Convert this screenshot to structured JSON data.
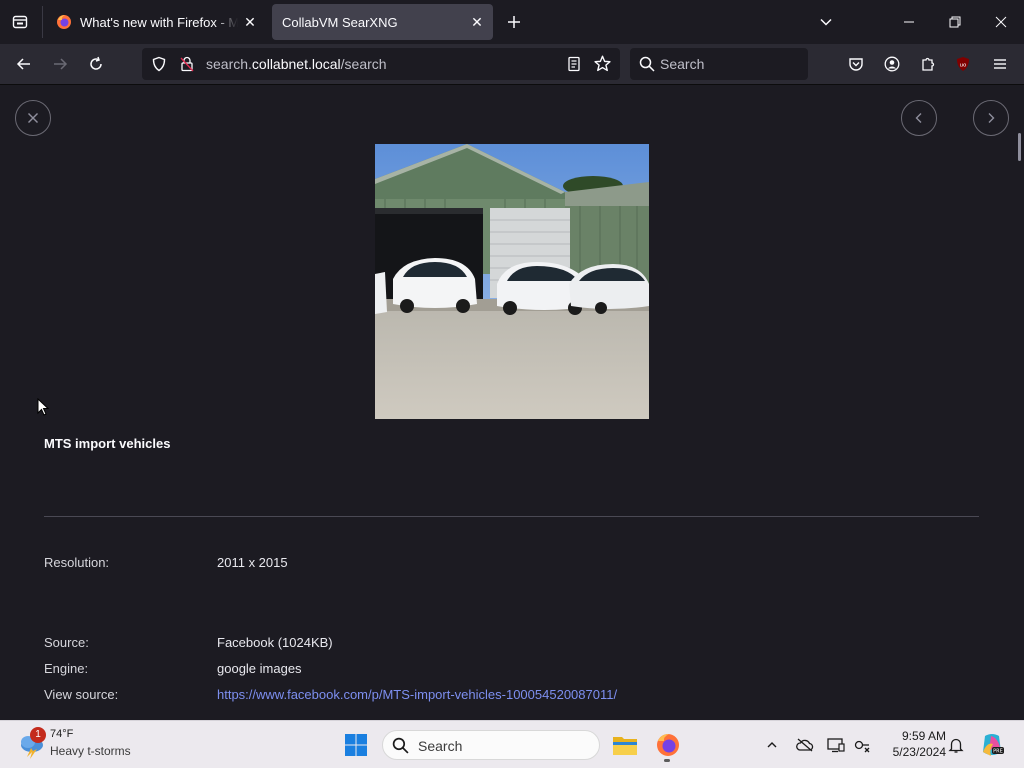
{
  "browser": {
    "tabs": [
      {
        "title": "What's new with Firefox - More",
        "active": false
      },
      {
        "title": "CollabVM SearXNG",
        "active": true
      }
    ],
    "url": {
      "prefix": "search.",
      "host": "collabnet.local",
      "path": "/search"
    },
    "search_placeholder": "Search"
  },
  "detail": {
    "title": "MTS import vehicles",
    "rows": [
      {
        "label": "Resolution:",
        "value": "2011 x 2015"
      },
      {
        "label": "Source:",
        "value": "Facebook (1024KB)"
      },
      {
        "label": "Engine:",
        "value": "google images"
      },
      {
        "label": "View source:",
        "value": "https://www.facebook.com/p/MTS-import-vehicles-100054520087011/"
      }
    ]
  },
  "taskbar": {
    "weather": {
      "temp": "74°F",
      "condition": "Heavy t-storms",
      "badge": "1"
    },
    "search_placeholder": "Search",
    "time": "9:59 AM",
    "date": "5/23/2024"
  },
  "colors": {
    "accent_link": "#7d8ff0",
    "active_tab": "#42414d",
    "toolbar": "#2b2a33"
  }
}
